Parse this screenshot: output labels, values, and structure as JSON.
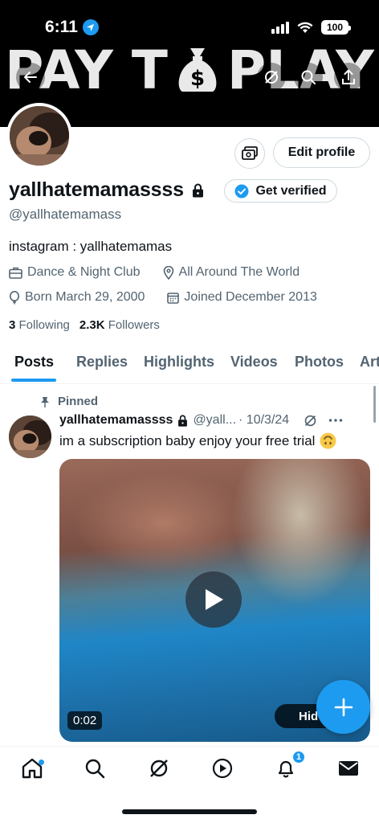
{
  "status_bar": {
    "time": "6:11",
    "battery": "100"
  },
  "banner": {
    "text_left": "PAY T",
    "text_right": " PLAY"
  },
  "profile": {
    "display_name": "yallhatemamassss",
    "handle": "@yallhatemamass",
    "bio": "instagram : yallhatemamas",
    "category": "Dance & Night Club",
    "location": "All Around The World",
    "born": "Born March 29, 2000",
    "joined": "Joined December 2013",
    "following_count": "3",
    "following_label": "Following",
    "followers_count": "2.3K",
    "followers_label": "Followers",
    "edit_profile_label": "Edit profile",
    "get_verified_label": "Get verified"
  },
  "tabs": [
    "Posts",
    "Replies",
    "Highlights",
    "Videos",
    "Photos",
    "Art"
  ],
  "pinned_post": {
    "pinned_label": "Pinned",
    "author_name": "yallhatemamassss",
    "author_handle": "@yall...",
    "date": "· 10/3/24",
    "text": "im a subscription baby enjoy your free trial",
    "video_duration": "0:02",
    "overlay_label": "Hid"
  },
  "bottom_nav": {
    "items": [
      "home-icon",
      "search-icon",
      "grok-icon",
      "video-icon",
      "notifications-icon",
      "messages-icon"
    ],
    "notifications_count": "1"
  },
  "colors": {
    "accent": "#1d9bf0",
    "text": "#0f1419",
    "secondary": "#536471"
  }
}
